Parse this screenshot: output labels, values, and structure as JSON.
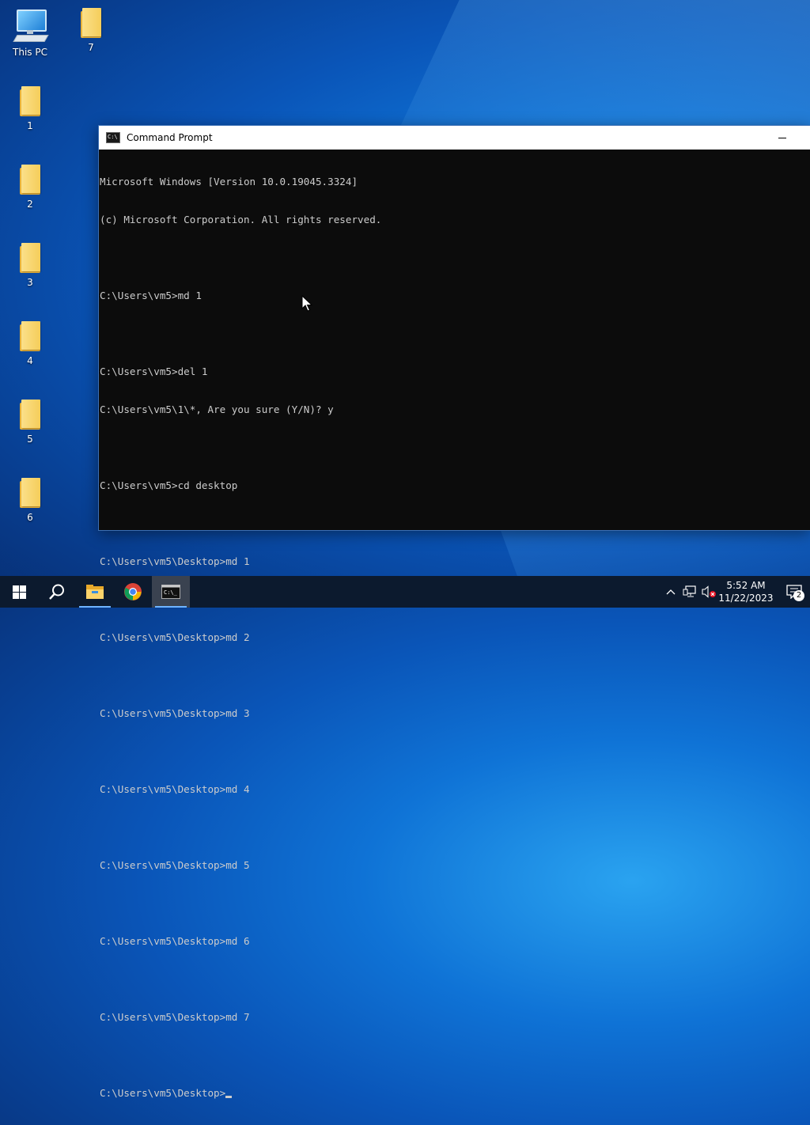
{
  "desktop": {
    "icons": [
      {
        "label": "This PC",
        "type": "pc"
      },
      {
        "label": "7",
        "type": "folder"
      },
      {
        "label": "1",
        "type": "folder"
      },
      {
        "label": "2",
        "type": "folder"
      },
      {
        "label": "3",
        "type": "folder"
      },
      {
        "label": "4",
        "type": "folder"
      },
      {
        "label": "5",
        "type": "folder"
      },
      {
        "label": "6",
        "type": "folder"
      }
    ]
  },
  "window": {
    "title": "Command Prompt",
    "lines": [
      "Microsoft Windows [Version 10.0.19045.3324]",
      "(c) Microsoft Corporation. All rights reserved.",
      "",
      "C:\\Users\\vm5>md 1",
      "",
      "C:\\Users\\vm5>del 1",
      "C:\\Users\\vm5\\1\\*, Are you sure (Y/N)? y",
      "",
      "C:\\Users\\vm5>cd desktop",
      "",
      "C:\\Users\\vm5\\Desktop>md 1",
      "",
      "C:\\Users\\vm5\\Desktop>md 2",
      "",
      "C:\\Users\\vm5\\Desktop>md 3",
      "",
      "C:\\Users\\vm5\\Desktop>md 4",
      "",
      "C:\\Users\\vm5\\Desktop>md 5",
      "",
      "C:\\Users\\vm5\\Desktop>md 6",
      "",
      "C:\\Users\\vm5\\Desktop>md 7",
      ""
    ],
    "prompt": "C:\\Users\\vm5\\Desktop>"
  },
  "taskbar": {
    "pinned": [
      "start-icon",
      "search-icon",
      "file-explorer-icon",
      "chrome-icon",
      "command-prompt-icon"
    ],
    "active": "command-prompt-icon"
  },
  "tray": {
    "time": "5:52 AM",
    "date": "11/22/2023",
    "notification_count": "2"
  },
  "colors": {
    "console_bg": "#0c0c0c",
    "console_fg": "#cccccc",
    "taskbar_bg": "#0c1a2e",
    "accent": "#6fb4ff"
  }
}
